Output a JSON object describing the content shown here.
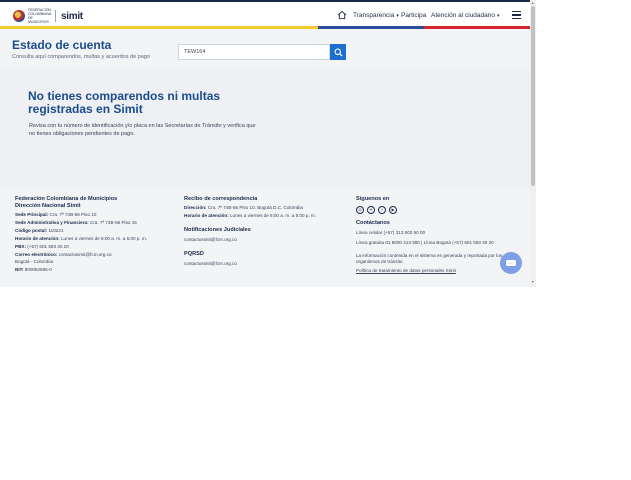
{
  "header": {
    "logo_org": "FEDERACIÓN COLOMBIANA DE MUNICIPIOS",
    "logo_brand": "simit",
    "nav": [
      "Transparencia",
      "Participa",
      "Atención al ciudadano"
    ]
  },
  "hero": {
    "title": "Estado de cuenta",
    "subtitle": "Consulta aquí comparendos, multas y acuerdos de pago",
    "search_value": "TEW164"
  },
  "result": {
    "title": "No tienes comparendos ni multas registradas en Simit",
    "description": "Revisa con tu número de identificación y/o placa en las Secretarías de Tránsito y verifica que no tienes obligaciones pendientes de pago."
  },
  "footer": {
    "col1": {
      "title1": "Federación Colombiana de Municipios",
      "title2": "Dirección Nacional Simit",
      "rows": [
        {
          "label": "Sede Principal:",
          "value": "Cra. 7ª 74B-56 Piso 10"
        },
        {
          "label": "Sede Administrativa y Financiera:",
          "value": "Cra. 7ª 74B-56 Piso 15"
        },
        {
          "label": "Código postal:",
          "value": "110221"
        },
        {
          "label": "Horario de atención:",
          "value": "Lunes a viernes de 8:00 a. m. a 5:00 p. m."
        },
        {
          "label": "PBX:",
          "value": "(+57) 601 593 40 20"
        },
        {
          "label": "Correo electrónico:",
          "value": "contactosimit@fcm.org.co"
        },
        {
          "label": "",
          "value": "Bogotá - Colombia"
        },
        {
          "label": "NIT:",
          "value": "800082665-0"
        }
      ]
    },
    "col2": {
      "title": "Recibo de correspondencia",
      "rows": [
        {
          "label": "Dirección:",
          "value": "Cra. 7ª 74B-56 Piso 10. Bogotá D.C. Colombia"
        },
        {
          "label": "Horario de atención:",
          "value": "Lunes a viernes de 8:00 a. m. a 5:00 p. m."
        }
      ],
      "notif_title": "Notificaciones Judiciales",
      "notif_email": "contactosimit@fcm.org.co",
      "pqrsd_title": "PQRSD",
      "pqrsd_email": "contactosimit@fcm.org.co"
    },
    "col3": {
      "follow_title": "Síguenos en",
      "social": [
        "instagram-icon",
        "twitter-icon",
        "facebook-icon",
        "youtube-icon"
      ],
      "contact_title": "Contáctanos",
      "lines": [
        "Línea celular (+57) 313 602 60 00",
        "Línea gratuita 01 8000 413 580 | Línea Bogotá (+57) 601 593 40 20"
      ],
      "disclaimer": "La información contenida en el sistema es generada y reportada por los organismos de tránsito.",
      "policy": "Política de tratamiento de datos personales Simit"
    }
  },
  "colors": {
    "primary": "#1b4c8c",
    "search_button": "#1b6fd1",
    "flag_yellow": "#f3c92c",
    "flag_blue": "#2a4d9b",
    "flag_red": "#d9232c"
  }
}
